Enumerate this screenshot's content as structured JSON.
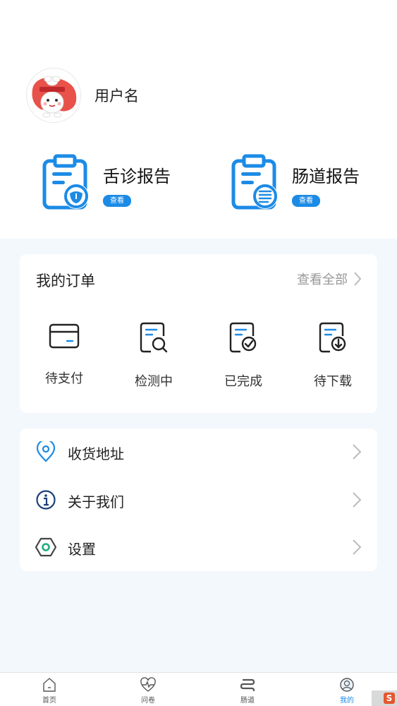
{
  "profile": {
    "username": "用户名"
  },
  "reports": [
    {
      "title": "舌诊报告",
      "button": "查看"
    },
    {
      "title": "肠道报告",
      "button": "查看"
    }
  ],
  "orders": {
    "title": "我的订单",
    "view_all": "查看全部",
    "items": [
      {
        "label": "待支付",
        "icon": "card-icon"
      },
      {
        "label": "检测中",
        "icon": "document-search-icon"
      },
      {
        "label": "已完成",
        "icon": "document-check-icon"
      },
      {
        "label": "待下载",
        "icon": "document-download-icon"
      }
    ]
  },
  "menu": {
    "items": [
      {
        "label": "收货地址",
        "icon": "location-pin-icon"
      },
      {
        "label": "关于我们",
        "icon": "info-icon"
      },
      {
        "label": "设置",
        "icon": "hexagon-settings-icon"
      }
    ]
  },
  "tabbar": {
    "items": [
      {
        "label": "首页",
        "icon": "home-icon"
      },
      {
        "label": "问卷",
        "icon": "heart-pulse-icon"
      },
      {
        "label": "肠道",
        "icon": "intestine-icon"
      },
      {
        "label": "我的",
        "icon": "profile-icon"
      }
    ],
    "active": "我的"
  },
  "colors": {
    "accent": "#1c8be6",
    "background": "#f3f8fd"
  }
}
